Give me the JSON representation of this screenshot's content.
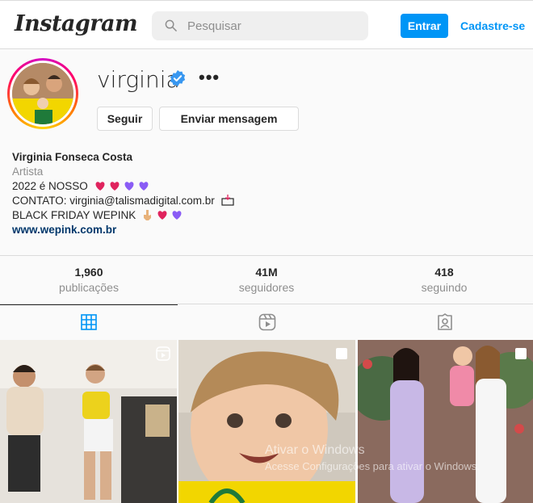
{
  "header": {
    "logo_text": "Instagram",
    "search_placeholder": "Pesquisar",
    "login_label": "Entrar",
    "signup_label": "Cadastre-se"
  },
  "profile": {
    "username": "virginia",
    "verified": true,
    "follow_label": "Seguir",
    "message_label": "Enviar mensagem",
    "full_name": "Virginia Fonseca Costa",
    "category": "Artista",
    "bio_line1": "2022 é NOSSO",
    "bio_line2": "CONTATO: virginia@talismadigital.com.br",
    "bio_line3": "BLACK FRIDAY WEPINK",
    "website": "www.wepink.com.br"
  },
  "stats": [
    {
      "value": "1,960",
      "label": "publicações"
    },
    {
      "value": "41M",
      "label": "seguidores"
    },
    {
      "value": "418",
      "label": "seguindo"
    }
  ],
  "tabs": [
    {
      "icon": "grid-icon",
      "active": true
    },
    {
      "icon": "reels-icon",
      "active": false
    },
    {
      "icon": "tagged-icon",
      "active": false
    }
  ],
  "posts": [
    {
      "type": "reel",
      "icon": "reel-badge-icon"
    },
    {
      "type": "carousel",
      "icon": "carousel-badge-icon"
    },
    {
      "type": "carousel",
      "icon": "carousel-badge-icon"
    }
  ],
  "watermark": {
    "line1": "Ativar o Windows",
    "line2": "Acesse Configurações para ativar o Windows."
  },
  "colors": {
    "accent": "#0095f6",
    "link": "#00376b",
    "verified": "#3897f0",
    "heart_red": "#e0245e",
    "heart_purple": "#8a5cf5"
  }
}
